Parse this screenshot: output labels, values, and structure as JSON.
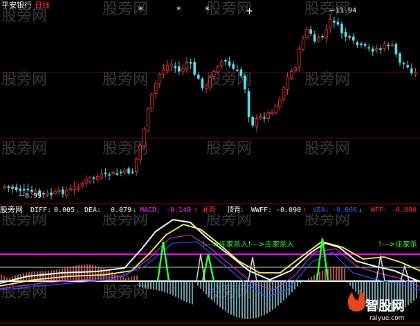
{
  "header": {
    "stock_name": "平安银行",
    "period": "日线"
  },
  "price_panel": {
    "high_label": "11.94",
    "low_label": "8.99",
    "star_markers": [
      "*",
      "*",
      "*",
      "+"
    ]
  },
  "indicator_bar": {
    "name": "股旁网",
    "diff_label": "DIFF:",
    "diff_value": "0.005",
    "diff_arrow": "↓",
    "dea_label": "DEA:",
    "dea_value": "0.079",
    "dea_arrow": "↓",
    "macd_label": "MACD:",
    "macd_value": "-0.149",
    "macd_arrow": "↑",
    "bottom_div": "底背",
    "top_div": "顶背:",
    "wwff_label": "WWFF:",
    "wwff_value": "-0.090",
    "wwff_arrow": "↑",
    "vea_label": "VEA:",
    "vea_value": "-0.066",
    "vea_arrow": "↓",
    "wff_label": "WFF:",
    "wff_value": "-0.090",
    "wff_arrow": "↑"
  },
  "annotations": {
    "kill_signal_1": "!--->庄家杀入!--->庄家杀入",
    "kill_signal_2": "!--->庄家杀"
  },
  "watermark": {
    "text": "股旁网",
    "logo_text": "智股网",
    "logo_url": "raiyue.com"
  },
  "colors": {
    "up_candle": "#ff3b3b",
    "down_candle": "#5ee0f0",
    "magenta_line": "#ff00ff",
    "yellow_line": "#ffff66",
    "white_line": "#ffffff",
    "green_line": "#33ff33",
    "purple_line": "#cc33cc",
    "blue_line": "#3355ff",
    "grid_red": "#8b0000"
  }
}
